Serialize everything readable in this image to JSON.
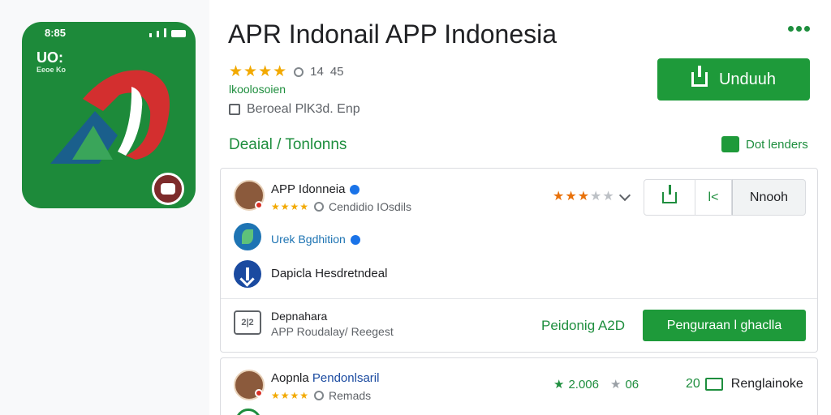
{
  "app": {
    "icon": {
      "status_time": "8:85",
      "label": "UO:",
      "sublabel": "Eeoe Ko"
    },
    "title": "APR Indonail APP Indonesia",
    "rating": "14",
    "rating_extra": "45",
    "developer": "lkoolosoien",
    "package": "Beroeal PlK3d. Enp"
  },
  "actions": {
    "install_label": "Unduuh"
  },
  "breadcrumb": "Deaial / Tonlonns",
  "links": {
    "dot_label": "Dot lenders"
  },
  "card": {
    "publisher": {
      "name": "APP Idonneia",
      "subtitle": "Cendidio IOsdils"
    },
    "buttons": {
      "link_glyph": "l<",
      "text": "Nnooh"
    },
    "link_item": "Urek Bgdhition",
    "plain_item": "Dapicla Hesdretndeal",
    "document": {
      "icon_text": "2|2",
      "title": "Depnahara",
      "subtitle": "APP Roudalay/ Reegest",
      "price": "Peidonig A2D",
      "button_label": "Penguraan l ghaclla"
    }
  },
  "review": {
    "name": "Aopnla",
    "name_highlight": "Pendonlsaril",
    "subtitle": "Remads",
    "stat1": "2.006",
    "stat2": "06",
    "count": "20",
    "label": "Renglainoke"
  },
  "colors": {
    "accent": "#1e9a3a",
    "link": "#1e74b3",
    "star": "#f2a900"
  }
}
